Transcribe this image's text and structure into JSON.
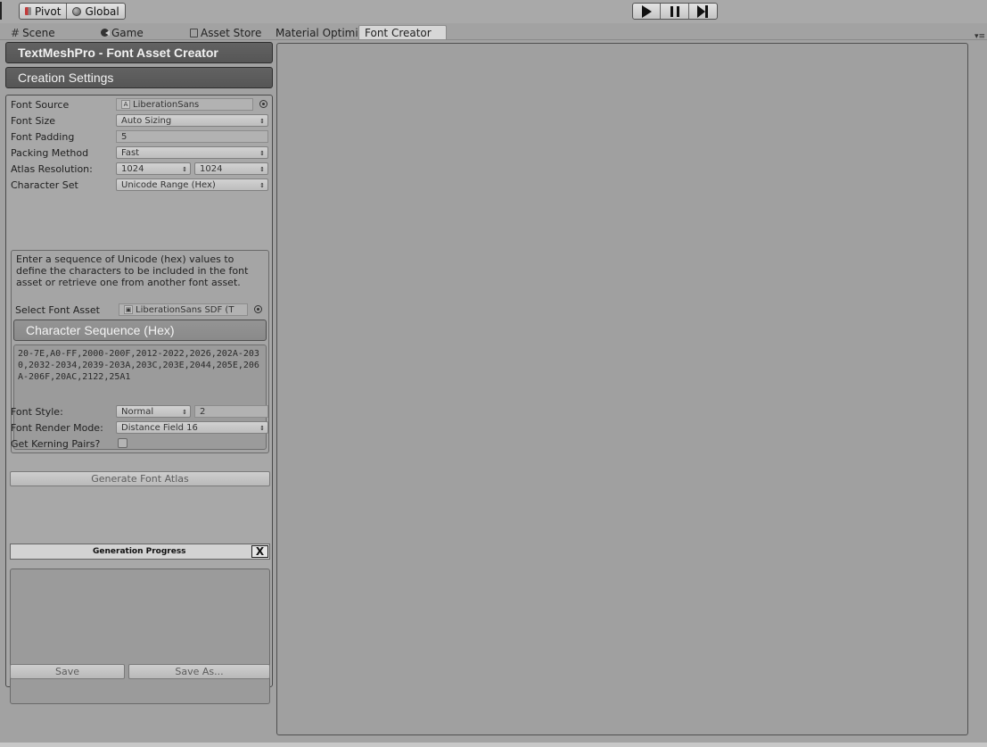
{
  "toolbar": {
    "pivot_label": "Pivot",
    "global_label": "Global"
  },
  "tabs": [
    {
      "label": "Scene",
      "icon": "hash-icon"
    },
    {
      "label": "Game",
      "icon": "pacman-icon"
    },
    {
      "label": "Asset Store",
      "icon": "bag-icon"
    },
    {
      "label": "Material Optimi"
    },
    {
      "label": "Font Creator",
      "active": true
    }
  ],
  "panel": {
    "title": "TextMeshPro - Font Asset Creator",
    "section": "Creation Settings",
    "font_source": {
      "label": "Font Source",
      "value": "LiberationSans"
    },
    "font_size": {
      "label": "Font Size",
      "value": "Auto Sizing"
    },
    "font_padding": {
      "label": "Font Padding",
      "value": "5"
    },
    "packing_method": {
      "label": "Packing Method",
      "value": "Fast"
    },
    "atlas_resolution": {
      "label": "Atlas Resolution:",
      "width": "1024",
      "height": "1024"
    },
    "character_set": {
      "label": "Character Set",
      "value": "Unicode Range (Hex)"
    },
    "help_text": "Enter a sequence of Unicode (hex) values to define the characters to be included in the font asset or retrieve one from another font asset.",
    "select_font_asset": {
      "label": "Select Font Asset",
      "value": "LiberationSans SDF (T"
    },
    "char_seq_header": "Character Sequence (Hex)",
    "char_seq_value": "20-7E,A0-FF,2000-200F,2012-2022,2026,202A-2030,2032-2034,2039-203A,203C,203E,2044,205E,206A-206F,20AC,2122,25A1",
    "font_style": {
      "label": "Font Style:",
      "value": "Normal",
      "amount": "2"
    },
    "render_mode": {
      "label": "Font Render Mode:",
      "value": "Distance Field 16"
    },
    "kerning": {
      "label": "Get Kerning Pairs?",
      "checked": false
    },
    "generate_label": "Generate Font Atlas",
    "progress_label": "Generation Progress",
    "progress_close": "X",
    "save_label": "Save",
    "save_as_label": "Save As..."
  }
}
